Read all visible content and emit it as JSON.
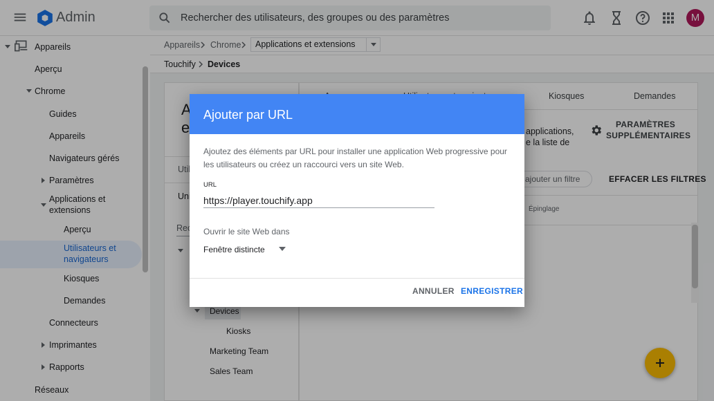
{
  "header": {
    "app_title": "Admin",
    "search_placeholder": "Rechercher des utilisateurs, des groupes ou des paramètres",
    "avatar_initial": "M",
    "brand_color": "#4285f4"
  },
  "sidebar": {
    "items": [
      {
        "label": "Appareils"
      },
      {
        "label": "Aperçu"
      },
      {
        "label": "Chrome"
      },
      {
        "label": "Guides"
      },
      {
        "label": "Appareils"
      },
      {
        "label": "Navigateurs gérés"
      },
      {
        "label": "Paramètres"
      },
      {
        "label": "Applications et"
      },
      {
        "label": "extensions"
      },
      {
        "label": "Aperçu"
      },
      {
        "label": "Utilisateurs et"
      },
      {
        "label": "navigateurs"
      },
      {
        "label": "Kiosques"
      },
      {
        "label": "Demandes"
      },
      {
        "label": "Connecteurs"
      },
      {
        "label": "Imprimantes"
      },
      {
        "label": "Rapports"
      },
      {
        "label": "Réseaux"
      }
    ]
  },
  "breadcrumb": {
    "items": [
      "Appareils",
      "Chrome"
    ],
    "current": "Applications et extensions"
  },
  "org_breadcrumb": {
    "parent": "Touchify",
    "current": "Devices"
  },
  "background": {
    "title_frag_1": "A",
    "title_frag_2": "e",
    "left_tab_frag": "Utili",
    "left_sub_frag": "Uni",
    "search_frag": "Rech",
    "org_tree": [
      "Devices",
      "Kiosks",
      "Marketing Team",
      "Sales Team"
    ],
    "tabs": [
      "A",
      "Utilisateurs et navigateurs",
      "Kiosques",
      "Demandes"
    ],
    "info_frag_1": "applications,",
    "info_frag_2": "e la liste de",
    "settings_btn_line1": "PARAMÈTRES",
    "settings_btn_line2": "SUPPLÉMENTAIRES",
    "filter_placeholder": "u ajouter un filtre",
    "clear_filters": "EFFACER LES FILTRES",
    "column_pin": "Épinglage"
  },
  "dialog": {
    "title": "Ajouter par URL",
    "description": "Ajoutez des éléments par URL pour installer une application Web progressive pour les utilisateurs ou créez un raccourci vers un site Web.",
    "url_label": "URL",
    "url_value": "https://player.touchify.app",
    "open_label": "Ouvrir le site Web dans",
    "open_value": "Fenêtre distincte",
    "cancel_label": "ANNULER",
    "save_label": "ENREGISTRER",
    "accent_color": "#1a73e8"
  }
}
